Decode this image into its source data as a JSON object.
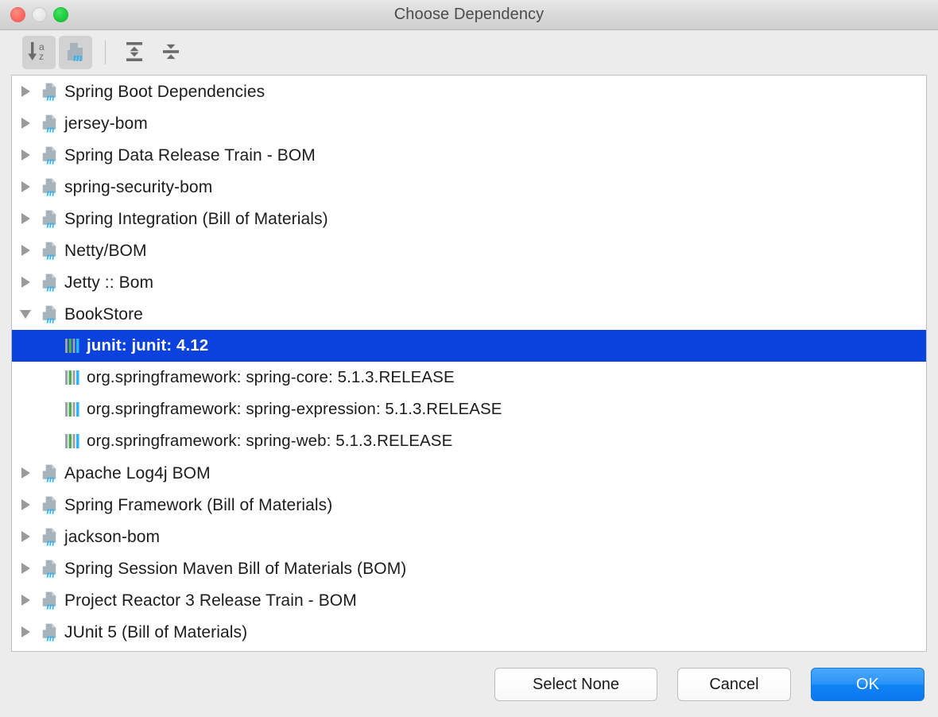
{
  "window": {
    "title": "Choose Dependency",
    "controls": [
      {
        "name": "close",
        "label": "Close"
      },
      {
        "name": "minimize",
        "label": "Minimize"
      },
      {
        "name": "zoom",
        "label": "Zoom"
      }
    ]
  },
  "toolbar": {
    "buttons": [
      {
        "name": "sort-alphabetically",
        "icon": "sort-az-icon",
        "label": "Sort alphabetically",
        "active": true
      },
      {
        "name": "group-by-maven-module",
        "icon": "maven-pom-icon",
        "label": "Group by Maven module",
        "active": true
      },
      {
        "name": "expand-all",
        "icon": "expand-all-icon",
        "label": "Expand All",
        "active": false
      },
      {
        "name": "collapse-all",
        "icon": "collapse-all-icon",
        "label": "Collapse All",
        "active": false
      }
    ]
  },
  "tree": {
    "rows": [
      {
        "label": "Spring Boot Dependencies",
        "icon": "maven-pom-icon",
        "type": "group",
        "state": "collapsed",
        "selected": false
      },
      {
        "label": "jersey-bom",
        "icon": "maven-pom-icon",
        "type": "group",
        "state": "collapsed",
        "selected": false
      },
      {
        "label": "Spring Data Release Train - BOM",
        "icon": "maven-pom-icon",
        "type": "group",
        "state": "collapsed",
        "selected": false
      },
      {
        "label": "spring-security-bom",
        "icon": "maven-pom-icon",
        "type": "group",
        "state": "collapsed",
        "selected": false
      },
      {
        "label": "Spring Integration (Bill of Materials)",
        "icon": "maven-pom-icon",
        "type": "group",
        "state": "collapsed",
        "selected": false
      },
      {
        "label": "Netty/BOM",
        "icon": "maven-pom-icon",
        "type": "group",
        "state": "collapsed",
        "selected": false
      },
      {
        "label": "Jetty :: Bom",
        "icon": "maven-pom-icon",
        "type": "group",
        "state": "collapsed",
        "selected": false
      },
      {
        "label": "BookStore",
        "icon": "maven-pom-icon",
        "type": "group",
        "state": "expanded",
        "selected": false
      },
      {
        "label": "junit: junit: 4.12",
        "icon": "library-icon",
        "type": "child",
        "state": "leaf",
        "selected": true
      },
      {
        "label": "org.springframework: spring-core: 5.1.3.RELEASE",
        "icon": "library-icon",
        "type": "child",
        "state": "leaf",
        "selected": false
      },
      {
        "label": "org.springframework: spring-expression: 5.1.3.RELEASE",
        "icon": "library-icon",
        "type": "child",
        "state": "leaf",
        "selected": false
      },
      {
        "label": "org.springframework: spring-web: 5.1.3.RELEASE",
        "icon": "library-icon",
        "type": "child",
        "state": "leaf",
        "selected": false
      },
      {
        "label": "Apache Log4j BOM",
        "icon": "maven-pom-icon",
        "type": "group",
        "state": "collapsed",
        "selected": false
      },
      {
        "label": "Spring Framework (Bill of Materials)",
        "icon": "maven-pom-icon",
        "type": "group",
        "state": "collapsed",
        "selected": false
      },
      {
        "label": "jackson-bom",
        "icon": "maven-pom-icon",
        "type": "group",
        "state": "collapsed",
        "selected": false
      },
      {
        "label": "Spring Session Maven Bill of Materials (BOM)",
        "icon": "maven-pom-icon",
        "type": "group",
        "state": "collapsed",
        "selected": false
      },
      {
        "label": "Project Reactor 3 Release Train - BOM",
        "icon": "maven-pom-icon",
        "type": "group",
        "state": "collapsed",
        "selected": false
      },
      {
        "label": "JUnit 5 (Bill of Materials)",
        "icon": "maven-pom-icon",
        "type": "group",
        "state": "collapsed",
        "selected": false
      }
    ]
  },
  "footer": {
    "select_none_label": "Select None",
    "cancel_label": "Cancel",
    "ok_label": "OK"
  },
  "colors": {
    "selection": "#0b41dd",
    "primary_button": "#1184f5",
    "maven_icon_gray": "#a7b3bb",
    "maven_icon_blue": "#29b6f6",
    "library_bar_gray": "#9aa3a8",
    "library_bar_green": "#4caf50",
    "library_bar_blue": "#29b6f6"
  }
}
